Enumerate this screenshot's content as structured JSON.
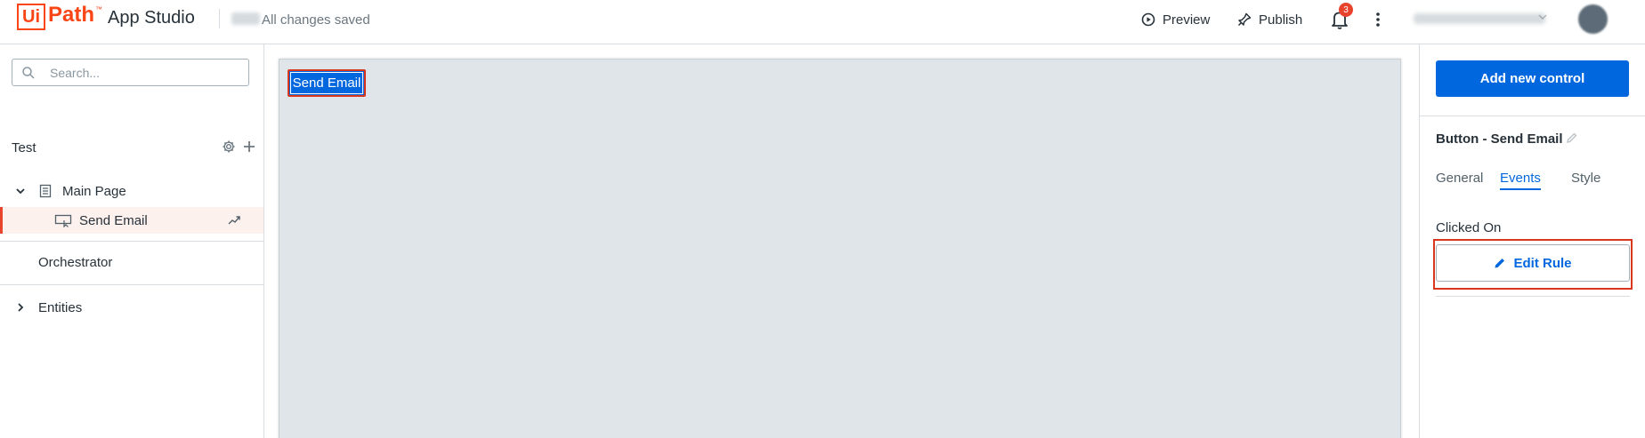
{
  "header": {
    "logo_ui": "Ui",
    "logo_path": "Path",
    "logo_tm": "™",
    "app_name": "App Studio",
    "save_status": "All changes saved",
    "preview_label": "Preview",
    "publish_label": "Publish",
    "notification_count": "3"
  },
  "left_panel": {
    "search_placeholder": "Search...",
    "app_title": "Test",
    "tree": {
      "main_page": "Main Page",
      "send_email": "Send Email",
      "orchestrator": "Orchestrator",
      "entities": "Entities"
    }
  },
  "canvas": {
    "button_label": "Send Email"
  },
  "right_panel": {
    "add_control_label": "Add new control",
    "control_title": "Button - Send Email",
    "tabs": {
      "general": "General",
      "events": "Events",
      "style": "Style"
    },
    "event_name": "Clicked On",
    "edit_rule_label": "Edit Rule"
  },
  "colors": {
    "brand": "#fa4616",
    "primary": "#0067df",
    "highlight": "#d9361e"
  }
}
